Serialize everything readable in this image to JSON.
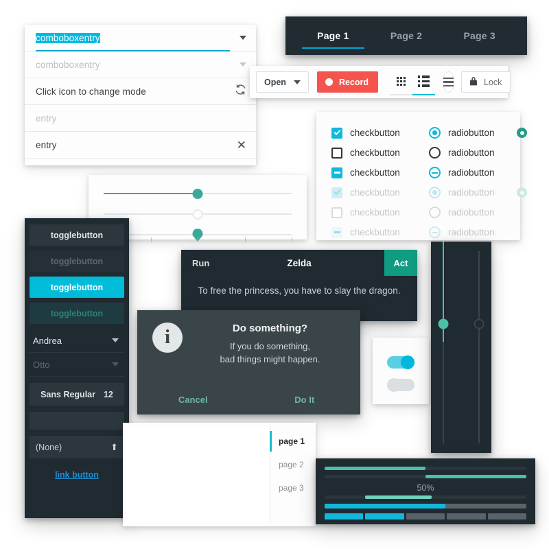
{
  "theme": {
    "accent_cyan": "#00bcd9",
    "accent_teal": "#3aa99a",
    "accent_green": "#109b83",
    "record_red": "#f4544c",
    "dark_bg": "#1f2a31",
    "panel_dark": "#202a31",
    "dialog_gray": "#3a454a",
    "link_blue": "#1e8fd5",
    "color_swatch": "#3b72b5"
  },
  "entries": {
    "rows": [
      {
        "text": "comboboxentry",
        "state": "selected",
        "icon": "chevron-down-icon"
      },
      {
        "text": "comboboxentry",
        "state": "disabled",
        "icon": "chevron-down-icon"
      },
      {
        "text": "Click icon to change mode",
        "state": "normal",
        "icon": "refresh-icon"
      },
      {
        "text": "entry",
        "state": "placeholder",
        "icon": "none"
      },
      {
        "text": "entry",
        "state": "normal",
        "icon": "clear-icon"
      }
    ],
    "refresh_glyph": "⟳",
    "clear_glyph": "✕"
  },
  "tabbar": {
    "tabs": [
      {
        "label": "Page 1",
        "active": true
      },
      {
        "label": "Page 2",
        "active": false
      },
      {
        "label": "Page 3",
        "active": false
      }
    ]
  },
  "toolbar": {
    "open_label": "Open",
    "record_label": "Record",
    "lock_label": "Lock",
    "lock_icon": "lock-icon",
    "grid_icon": "grid-view-icon",
    "list_icon": "list-view-icon",
    "menu_icon": "hamburger-menu-icon",
    "active_view": "list-view-icon"
  },
  "checks": {
    "rows": [
      {
        "check_label": "checkbutton",
        "check_state": "checked",
        "radio_label": "radiobutton",
        "radio_state": "selected",
        "extra": "spinner"
      },
      {
        "check_label": "checkbutton",
        "check_state": "unchecked",
        "radio_label": "radiobutton",
        "radio_state": "unselected",
        "extra": "none"
      },
      {
        "check_label": "checkbutton",
        "check_state": "mixed",
        "radio_label": "radiobutton",
        "radio_state": "mixed",
        "extra": "none"
      },
      {
        "check_label": "checkbutton",
        "check_state": "checked-disabled",
        "radio_label": "radiobutton",
        "radio_state": "selected-disabled",
        "extra": "spinner-disabled"
      },
      {
        "check_label": "checkbutton",
        "check_state": "unchecked-disabled",
        "radio_label": "radiobutton",
        "radio_state": "unselected-disabled",
        "extra": "none"
      },
      {
        "check_label": "checkbutton",
        "check_state": "mixed-disabled",
        "radio_label": "radiobutton",
        "radio_state": "mixed-disabled",
        "extra": "none"
      }
    ]
  },
  "hsliders": [
    {
      "value": 50,
      "fill": true,
      "knob": "round"
    },
    {
      "value": 50,
      "fill": false,
      "knob": "hollow"
    },
    {
      "value": 50,
      "fill": false,
      "knob": "marker",
      "marks": [
        0,
        25,
        50,
        75,
        100
      ]
    }
  ],
  "widgets": {
    "toggles": [
      {
        "label": "togglebutton",
        "state": "normal"
      },
      {
        "label": "togglebutton",
        "state": "disabled"
      },
      {
        "label": "togglebutton",
        "state": "active"
      },
      {
        "label": "togglebutton",
        "state": "active-disabled"
      }
    ],
    "combos": [
      {
        "value": "Andrea",
        "state": "normal"
      },
      {
        "value": "Otto",
        "state": "disabled"
      }
    ],
    "font_button": {
      "family": "Sans Regular",
      "size": "12"
    },
    "color_button": {
      "value": "#3b72b5"
    },
    "file_button": {
      "label": "(None)",
      "icon": "upload-icon",
      "glyph": "⬆"
    },
    "link_button": {
      "label": "link button"
    }
  },
  "zelda_dialog": {
    "left_label": "Run",
    "title": "Zelda",
    "action_label": "Act",
    "body": "To free the princess, you have to slay the dragon."
  },
  "do_something_dialog": {
    "icon": "info-icon",
    "icon_glyph": "i",
    "title": "Do something?",
    "line1": "If you do something,",
    "line2": "bad things might happen.",
    "cancel_label": "Cancel",
    "confirm_label": "Do It"
  },
  "switches": [
    {
      "state": "on"
    },
    {
      "state": "off"
    }
  ],
  "vsliders": [
    {
      "value": 50,
      "fill": true,
      "knob": "round"
    },
    {
      "value": 50,
      "fill": false,
      "knob": "hollow"
    }
  ],
  "notebook": {
    "pages": [
      {
        "label": "page 1",
        "active": true
      },
      {
        "label": "page 2",
        "active": false
      },
      {
        "label": "page 3",
        "active": false
      }
    ]
  },
  "progress": {
    "label": "50%",
    "bars": [
      {
        "value": 50,
        "style": "teal-left",
        "track": "#2a353c",
        "fill": "#4dbfa8"
      },
      {
        "value": 50,
        "style": "teal-right",
        "track": "#2a353c",
        "fill": "#4dbfa8"
      },
      {
        "value": 30,
        "style": "teal-middle",
        "track": "#2a353c",
        "fill": "#6fd2bb",
        "offset": 14
      },
      {
        "value": 60,
        "style": "cyan",
        "track": "#5a6368",
        "fill": "#13b7dd"
      }
    ],
    "segments": [
      {
        "fill": 100,
        "color": "#13b7dd"
      },
      {
        "fill": 100,
        "color": "#13b7dd"
      },
      {
        "fill": 10,
        "color": "#13b7dd"
      },
      {
        "fill": 0,
        "color": "#13b7dd"
      },
      {
        "fill": 0,
        "color": "#13b7dd"
      }
    ],
    "segment_track": "#5a6368"
  }
}
